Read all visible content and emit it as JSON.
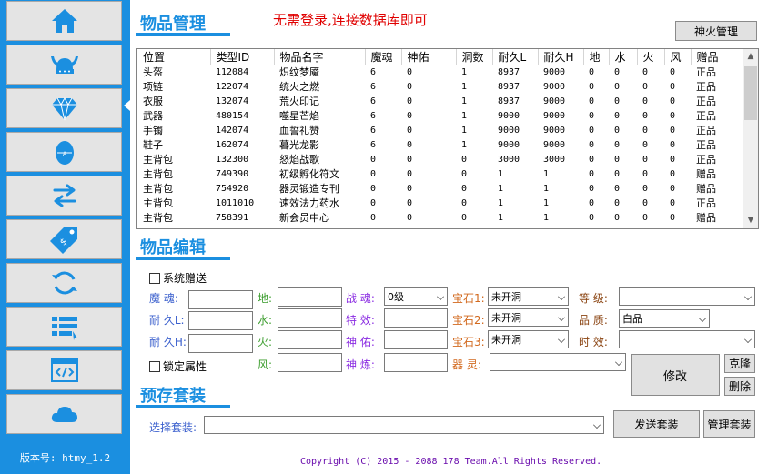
{
  "sidebar": {
    "version": "版本号: htmy_1.2",
    "icons": [
      "home-icon",
      "viking-helmet-icon",
      "diamond-icon",
      "egg-icon",
      "swap-arrows-icon",
      "price-tag-icon",
      "refresh-icon",
      "list-icon",
      "code-window-icon",
      "cloud-icon"
    ]
  },
  "header": {
    "title": "物品管理",
    "notice": "无需登录,连接数据库即可",
    "shenhuo_button": "神火管理"
  },
  "table": {
    "columns": [
      "位置",
      "类型ID",
      "物品名字",
      "魔魂",
      "神佑",
      "洞数",
      "耐久L",
      "耐久H",
      "地",
      "水",
      "火",
      "风",
      "赠品"
    ],
    "rows": [
      [
        "头盔",
        "112084",
        "炽纹梦魇",
        "6",
        "0",
        "1",
        "8937",
        "9000",
        "0",
        "0",
        "0",
        "0",
        "正品"
      ],
      [
        "项链",
        "122074",
        "统火之燃",
        "6",
        "0",
        "1",
        "8937",
        "9000",
        "0",
        "0",
        "0",
        "0",
        "正品"
      ],
      [
        "衣服",
        "132074",
        "荒火印记",
        "6",
        "0",
        "1",
        "8937",
        "9000",
        "0",
        "0",
        "0",
        "0",
        "正品"
      ],
      [
        "武器",
        "480154",
        "噬星芒焰",
        "6",
        "0",
        "1",
        "9000",
        "9000",
        "0",
        "0",
        "0",
        "0",
        "正品"
      ],
      [
        "手镯",
        "142074",
        "血誓礼赞",
        "6",
        "0",
        "1",
        "9000",
        "9000",
        "0",
        "0",
        "0",
        "0",
        "正品"
      ],
      [
        "鞋子",
        "162074",
        "暮光龙影",
        "6",
        "0",
        "1",
        "9000",
        "9000",
        "0",
        "0",
        "0",
        "0",
        "正品"
      ],
      [
        "主背包",
        "132300",
        "怒焰战歌",
        "0",
        "0",
        "0",
        "3000",
        "3000",
        "0",
        "0",
        "0",
        "0",
        "正品"
      ],
      [
        "主背包",
        "749390",
        "初级孵化符文",
        "0",
        "0",
        "0",
        "1",
        "1",
        "0",
        "0",
        "0",
        "0",
        "赠品"
      ],
      [
        "主背包",
        "754920",
        "器灵锻造专刊",
        "0",
        "0",
        "0",
        "1",
        "1",
        "0",
        "0",
        "0",
        "0",
        "赠品"
      ],
      [
        "主背包",
        "1011010",
        "速效法力药水",
        "0",
        "0",
        "0",
        "1",
        "1",
        "0",
        "0",
        "0",
        "0",
        "正品"
      ],
      [
        "主背包",
        "758391",
        "新会员中心",
        "0",
        "0",
        "0",
        "1",
        "1",
        "0",
        "0",
        "0",
        "0",
        "赠品"
      ]
    ]
  },
  "edit": {
    "title": "物品编辑",
    "system_gift": "系统赠送",
    "lock_attr": "锁定属性",
    "labels": {
      "mohun": "魔 魂:",
      "naijiu_l": "耐 久L:",
      "naijiu_h": "耐 久H:",
      "di": "地:",
      "shui": "水:",
      "huo": "火:",
      "feng": "风:",
      "zhanhun": "战 魂:",
      "texiao": "特 效:",
      "shenyou": "神 佑:",
      "shenlian": "神 炼:",
      "gem1": "宝石1:",
      "gem2": "宝石2:",
      "gem3": "宝石3:",
      "qiling": "器 灵:",
      "dengji": "等 级:",
      "pinzhi": "品 质:",
      "shixiao": "时 效:"
    },
    "values": {
      "zhanhun": "0级",
      "gem1": "未开洞",
      "gem2": "未开洞",
      "gem3": "未开洞",
      "pinzhi": "白品"
    },
    "modify_button": "修改",
    "clone_button": "克隆",
    "delete_button": "删除"
  },
  "preset": {
    "title": "预存套装",
    "select_label": "选择套装:",
    "send_button": "发送套装",
    "manage_button": "管理套装"
  },
  "footer": {
    "copyright": "Copyright (C) 2015 - 2088 178 Team.All Rights Reserved."
  }
}
